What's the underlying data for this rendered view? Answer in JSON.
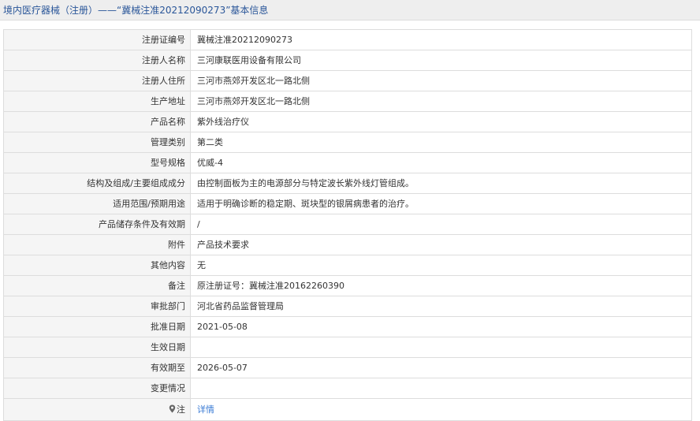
{
  "header": {
    "title": "境内医疗器械（注册）——“冀械注准20212090273”基本信息"
  },
  "rows": [
    {
      "label": "注册证编号",
      "value": "冀械注准20212090273"
    },
    {
      "label": "注册人名称",
      "value": "三河康联医用设备有限公司"
    },
    {
      "label": "注册人住所",
      "value": "三河市燕郊开发区北一路北侧"
    },
    {
      "label": "生产地址",
      "value": "三河市燕郊开发区北一路北侧"
    },
    {
      "label": "产品名称",
      "value": "紫外线治疗仪"
    },
    {
      "label": "管理类别",
      "value": "第二类"
    },
    {
      "label": "型号规格",
      "value": "优威-4"
    },
    {
      "label": "结构及组成/主要组成成分",
      "value": "由控制面板为主的电源部分与特定波长紫外线灯管组成。"
    },
    {
      "label": "适用范围/预期用途",
      "value": "适用于明确诊断的稳定期、斑块型的银屑病患者的治疗。"
    },
    {
      "label": "产品储存条件及有效期",
      "value": "/"
    },
    {
      "label": "附件",
      "value": "产品技术要求"
    },
    {
      "label": "其他内容",
      "value": "无"
    },
    {
      "label": "备注",
      "value": "原注册证号：冀械注准20162260390"
    },
    {
      "label": "审批部门",
      "value": "河北省药品监督管理局"
    },
    {
      "label": "批准日期",
      "value": "2021-05-08"
    },
    {
      "label": "生效日期",
      "value": ""
    },
    {
      "label": "有效期至",
      "value": "2026-05-07"
    },
    {
      "label": "变更情况",
      "value": ""
    }
  ],
  "note_row": {
    "icon": "map-pin-icon",
    "label": "注",
    "link_text": "详情"
  }
}
